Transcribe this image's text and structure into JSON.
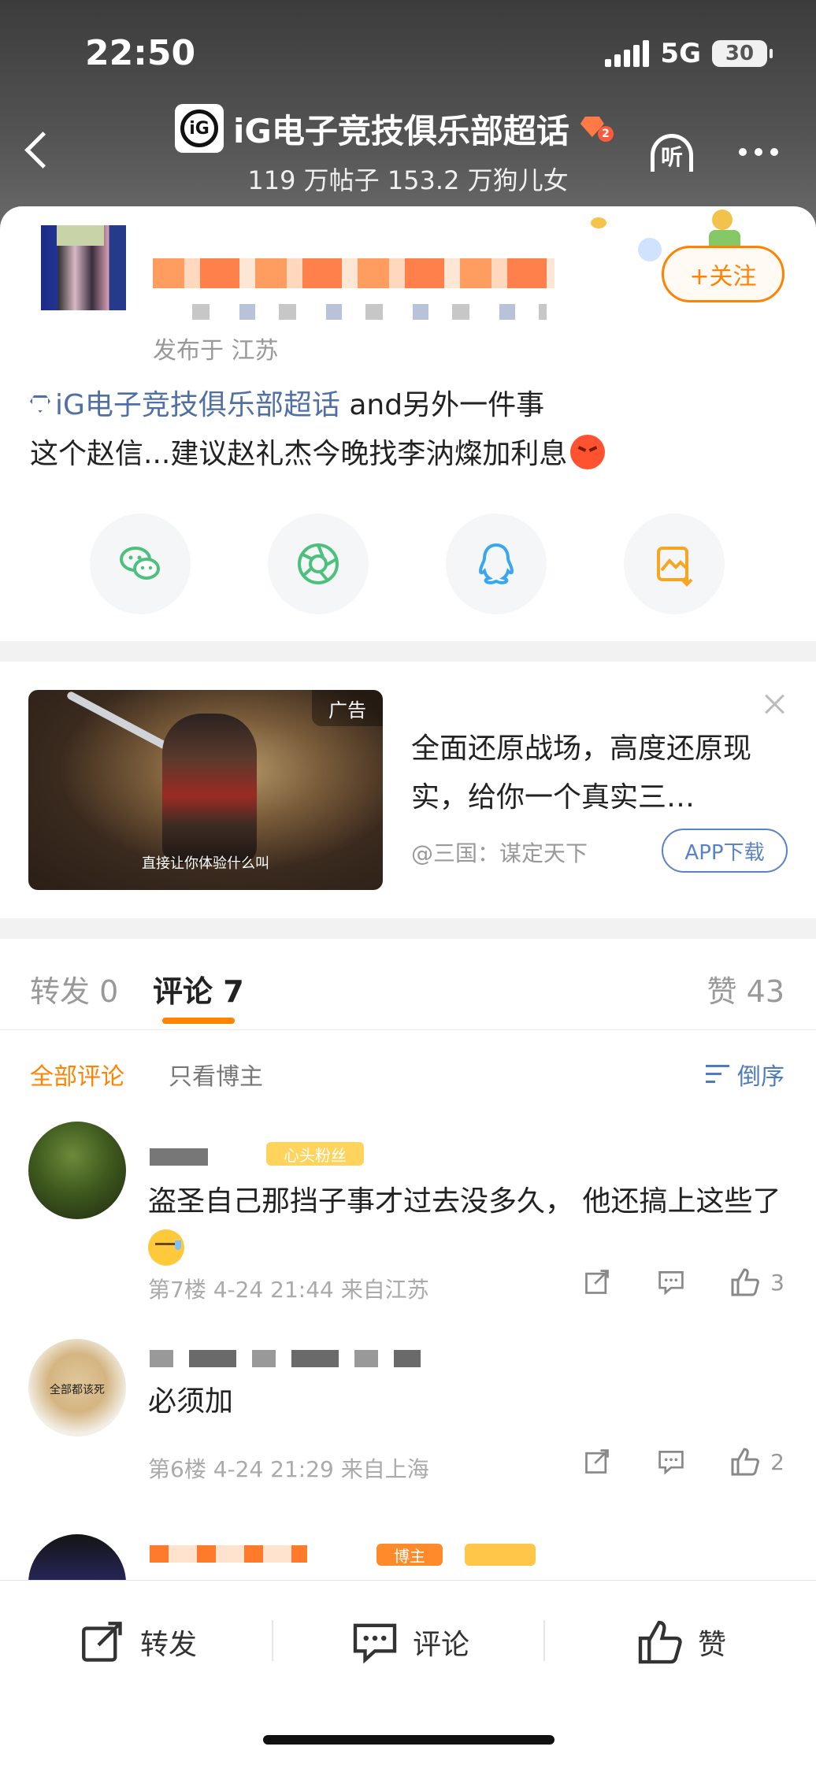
{
  "status_bar": {
    "time": "22:50",
    "network": "5G",
    "battery": "30"
  },
  "header": {
    "title": "iG电子竞技俱乐部超话",
    "subtitle": "119 万帖子 153.2 万狗儿女",
    "logo_text": "iG",
    "level": "2",
    "listen_label": "听"
  },
  "post": {
    "location": "发布于 江苏",
    "follow_label": "+关注",
    "topic": "iG电子竞技俱乐部超话",
    "line1_rest": " and另外一件事",
    "line2": "这个赵信...建议赵礼杰今晚找李汭燦加利息",
    "share_icons": [
      "wechat-icon",
      "moments-icon",
      "qq-icon",
      "save-image-icon"
    ]
  },
  "ad": {
    "badge": "广告",
    "caption": "直接让你体验什么叫",
    "headline": "全面还原战场，高度还原现实，给你一个真实三…",
    "source": "@三国：谋定天下",
    "download_label": "APP下载"
  },
  "comments_section": {
    "tabs": {
      "repost_label": "转发",
      "repost_count": "0",
      "comment_label": "评论",
      "comment_count": "7",
      "like_label": "赞",
      "like_count": "43"
    },
    "filters": {
      "all": "全部评论",
      "author_only": "只看博主",
      "sort": "倒序"
    },
    "items": [
      {
        "fan_badge": "心头粉丝",
        "text": "盗圣自己那挡子事才过去没多久， 他还搞上这些了",
        "meta": "第7楼 4-24 21:44 来自江苏",
        "likes": "3"
      },
      {
        "avatar_caption": "全部都该死",
        "text": "必须加",
        "meta": "第6楼 4-24 21:29 来自上海",
        "likes": "2"
      },
      {
        "badge": "博主"
      }
    ]
  },
  "bottom_bar": {
    "repost": "转发",
    "comment": "评论",
    "like": "赞"
  },
  "colors": {
    "accent": "#ff8200",
    "link": "#4f6fa6",
    "sort_blue": "#4f7bc0"
  }
}
